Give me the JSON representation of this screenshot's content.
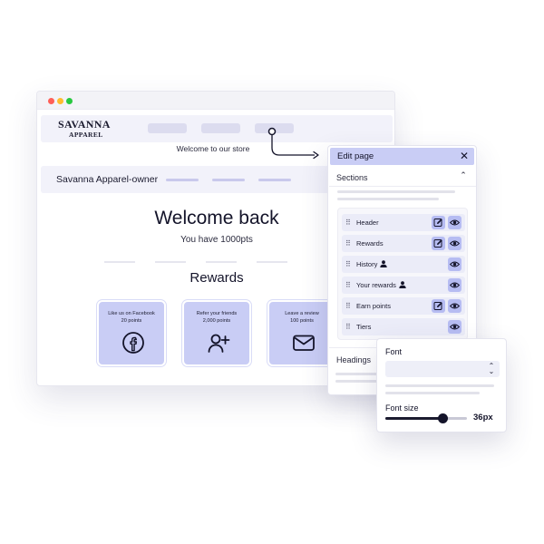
{
  "store": {
    "logo_line1": "SAVANNA",
    "logo_line2": "APPAREL",
    "welcome_strip": "Welcome to our store",
    "owner_label": "Savanna Apparel-owner",
    "welcome_title": "Welcome back",
    "points_text": "You have 1000pts",
    "rewards_title": "Rewards",
    "reward_cards": [
      {
        "title": "Like us on Facebook",
        "points": "20 points",
        "icon": "facebook-icon"
      },
      {
        "title": "Refer your friends",
        "points": "2,000 points",
        "icon": "add-user-icon"
      },
      {
        "title": "Leave a review",
        "points": "100 points",
        "icon": "mail-icon"
      }
    ]
  },
  "edit_panel": {
    "title": "Edit page",
    "close_icon": "close-icon",
    "sections_label": "Sections",
    "sections_chevron": "chevron-up-icon",
    "items": [
      {
        "label": "Header",
        "edit": true,
        "visible": true,
        "locked_icon": false
      },
      {
        "label": "Rewards",
        "edit": true,
        "visible": true,
        "locked_icon": false
      },
      {
        "label": "History",
        "edit": false,
        "visible": true,
        "locked_icon": true
      },
      {
        "label": "Your rewards",
        "edit": false,
        "visible": true,
        "locked_icon": true
      },
      {
        "label": "Earn points",
        "edit": true,
        "visible": true,
        "locked_icon": false
      },
      {
        "label": "Tiers",
        "edit": false,
        "visible": true,
        "locked_icon": false
      }
    ],
    "headings_label": "Headings"
  },
  "font_panel": {
    "font_label": "Font",
    "font_value": "",
    "font_size_label": "Font size",
    "font_size_value": "36px",
    "font_size_fraction": 0.7
  },
  "colors": {
    "accent": "#c9cdf5",
    "accent_button": "#b6bcf2",
    "text_dark": "#14142a"
  }
}
